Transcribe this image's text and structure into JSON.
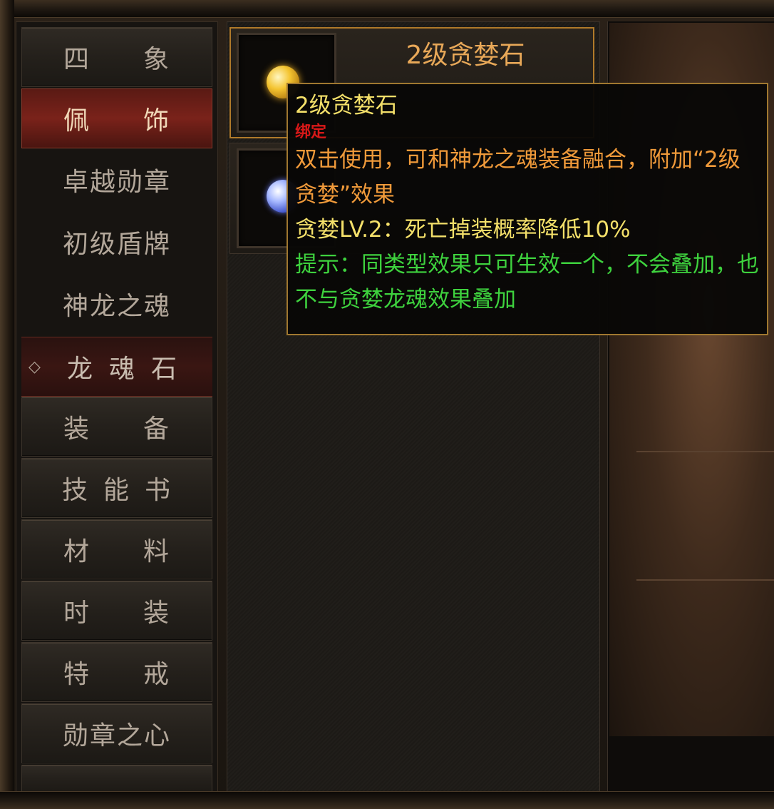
{
  "sidebar": {
    "tabs": [
      {
        "label": "四象",
        "chars": [
          "四",
          "象"
        ],
        "state": "normal"
      },
      {
        "label": "佩饰",
        "chars": [
          "佩",
          "饰"
        ],
        "state": "active"
      },
      {
        "label": "卓越勋章",
        "state": "plain"
      },
      {
        "label": "初级盾牌",
        "state": "plain"
      },
      {
        "label": "神龙之魂",
        "state": "plain"
      },
      {
        "label": "龙魂石",
        "chars": [
          "龙",
          "魂",
          "石"
        ],
        "state": "selected",
        "marker": "◇"
      },
      {
        "label": "装备",
        "chars": [
          "装",
          "备"
        ],
        "state": "normal"
      },
      {
        "label": "技能书",
        "chars": [
          "技",
          "能",
          "书"
        ],
        "state": "normal"
      },
      {
        "label": "材料",
        "chars": [
          "材",
          "料"
        ],
        "state": "normal"
      },
      {
        "label": "时装",
        "chars": [
          "时",
          "装"
        ],
        "state": "normal"
      },
      {
        "label": "特戒",
        "chars": [
          "特",
          "戒"
        ],
        "state": "normal"
      },
      {
        "label": "勋章之心",
        "state": "normal"
      }
    ]
  },
  "items": [
    {
      "title": "2级贪婪石",
      "icon": "gold-gem-icon"
    },
    {
      "title": "",
      "icon": "blue-gem-icon"
    }
  ],
  "tooltip": {
    "name": "2级贪婪石",
    "bind": "绑定",
    "description": "双击使用，可和神龙之魂装备融合，附加“2级贪婪”效果",
    "effect": "贪婪LV.2：死亡掉装概率降低10%",
    "hint": "提示：同类型效果只可生效一个，不会叠加，也不与贪婪龙魂效果叠加"
  },
  "colors": {
    "tooltip_name": "#f4e06a",
    "tooltip_bind": "#d81818",
    "tooltip_description": "#f09a3a",
    "tooltip_hint": "#3ed23e",
    "card_title": "#e8a858",
    "active_tab": "#7a221a"
  }
}
